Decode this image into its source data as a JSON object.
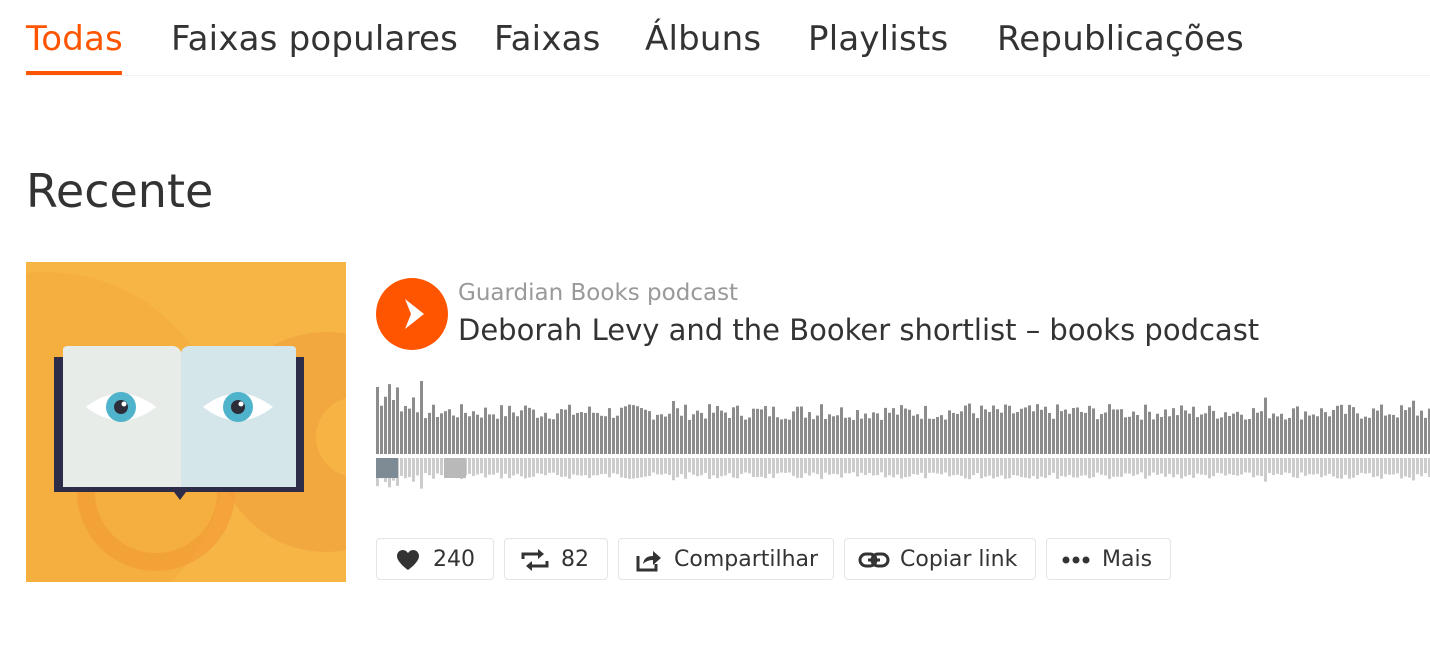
{
  "tabs": [
    {
      "label": "Todas",
      "active": true
    },
    {
      "label": "Faixas populares"
    },
    {
      "label": "Faixas"
    },
    {
      "label": "Álbuns"
    },
    {
      "label": "Playlists"
    },
    {
      "label": "Republicações"
    }
  ],
  "section": {
    "title": "Recente"
  },
  "track": {
    "uploader": "Guardian Books podcast",
    "title": "Deborah Levy and the Booker shortlist – books podcast",
    "artwork_icon": "open-book-with-eyes-icon"
  },
  "actions": {
    "like": {
      "count": "240",
      "icon": "heart-icon"
    },
    "repost": {
      "count": "82",
      "icon": "repost-icon"
    },
    "share": {
      "label": "Compartilhar",
      "icon": "share-icon"
    },
    "copy_link": {
      "label": "Copiar link",
      "icon": "link-icon"
    },
    "more": {
      "label": "Mais",
      "icon": "more-icon"
    }
  },
  "colors": {
    "accent": "#ff5500",
    "waveform_top": "#8c8c8c",
    "waveform_bottom": "#cccccc",
    "artwork_bg": "#f7b546"
  }
}
